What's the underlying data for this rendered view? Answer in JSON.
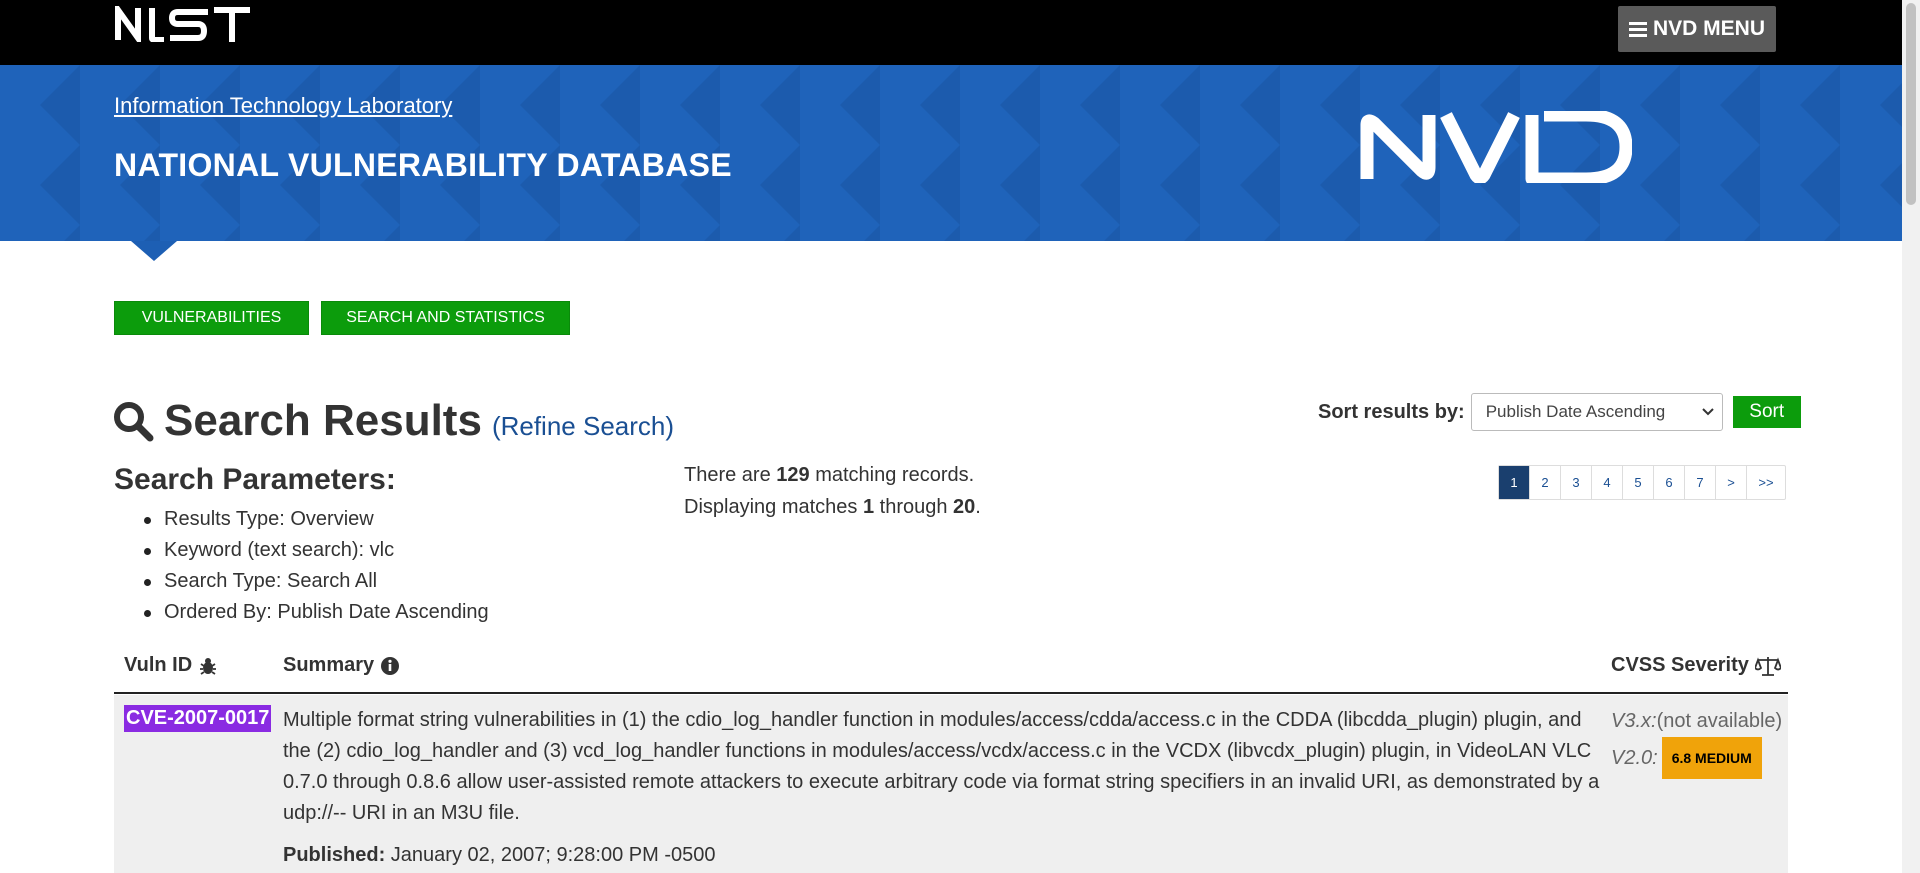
{
  "header": {
    "logo_text": "NIST",
    "menu_label": "NVD MENU"
  },
  "banner": {
    "lab_link": "Information Technology Laboratory",
    "title": "NATIONAL VULNERABILITY DATABASE",
    "logo_text": "NVD",
    "color": "#1d5fb4"
  },
  "nav": {
    "vulnerabilities": "VULNERABILITIES",
    "search_statistics": "SEARCH AND STATISTICS"
  },
  "results": {
    "title": "Search Results",
    "refine": "(Refine Search)",
    "sort_label": "Sort results by:",
    "sort_value": "Publish Date Ascending",
    "sort_button": "Sort"
  },
  "params": {
    "title": "Search Parameters:",
    "items": [
      "Results Type: Overview",
      "Keyword (text search): vlc",
      "Search Type: Search All",
      "Ordered By: Publish Date Ascending"
    ]
  },
  "records": {
    "line1_pre": "There are ",
    "count": "129",
    "line1_post": " matching records.",
    "line2_pre": "Displaying matches ",
    "from": "1",
    "line2_mid": " through ",
    "to": "20",
    "line2_post": "."
  },
  "pager": {
    "pages": [
      "1",
      "2",
      "3",
      "4",
      "5",
      "6",
      "7",
      ">",
      ">>"
    ],
    "active": "1"
  },
  "table": {
    "headers": {
      "vuln_id": "Vuln ID",
      "summary": "Summary",
      "cvss": "CVSS Severity"
    },
    "rows": [
      {
        "id": "CVE-2007-0017",
        "summary": "Multiple format string vulnerabilities in (1) the cdio_log_handler function in modules/access/cdda/access.c in the CDDA (libcdda_plugin) plugin, and the (2) cdio_log_handler and (3) vcd_log_handler functions in modules/access/vcdx/access.c in the VCDX (libvcdx_plugin) plugin, in VideoLAN VLC 0.7.0 through 0.8.6 allow user-assisted remote attackers to execute arbitrary code via format string specifiers in an invalid URI, as demonstrated by a udp://-- URI in an M3U file.",
        "published_label": "Published:",
        "published_value": "January 02, 2007; 9:28:00 PM -0500",
        "v3_label": "V3.x:",
        "v3_value": "(not available)",
        "v2_label": "V2.0:",
        "v2_badge": "6.8 MEDIUM",
        "badge_color": "#f0a30a"
      }
    ]
  }
}
